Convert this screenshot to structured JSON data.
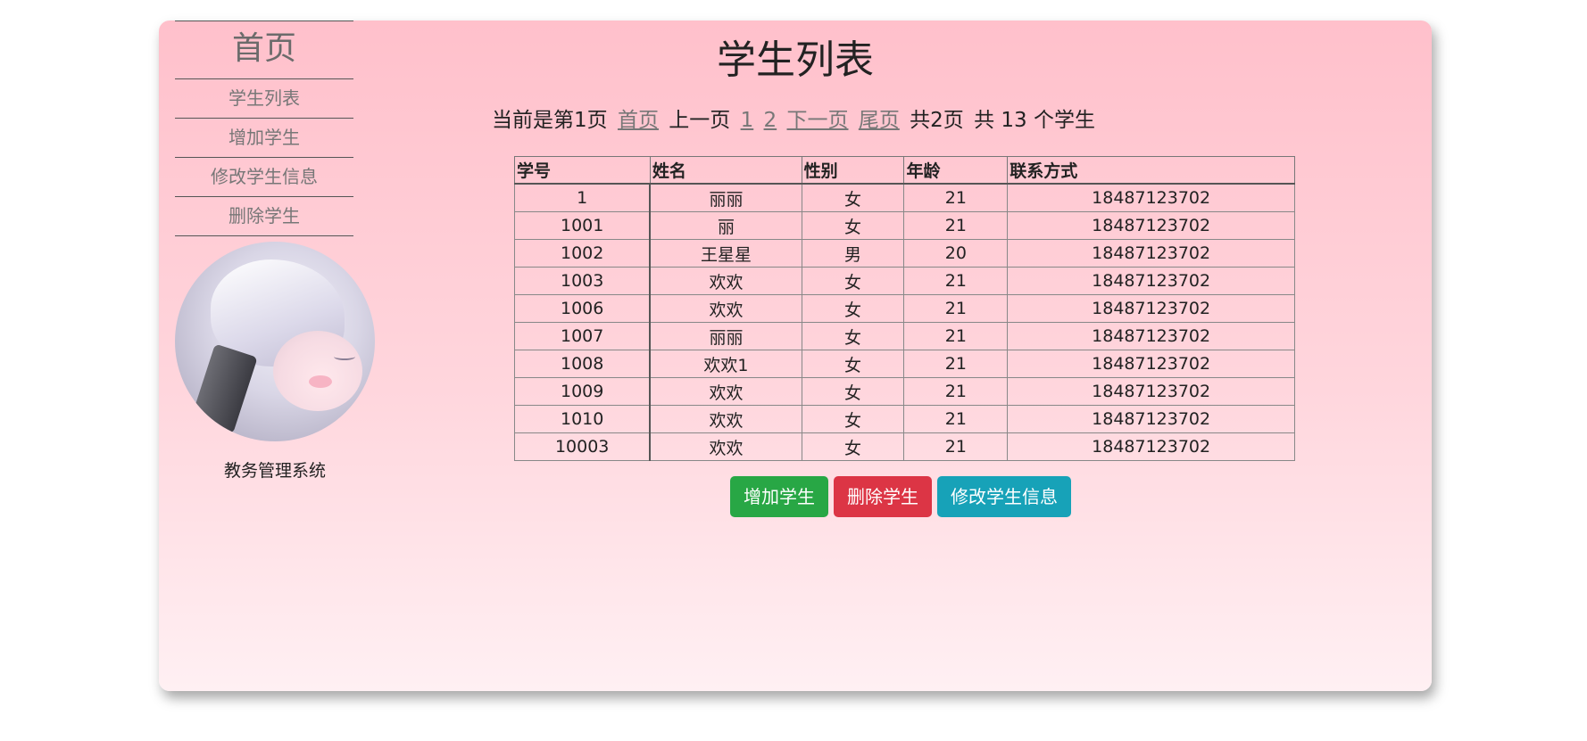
{
  "sidebar": {
    "home": "首页",
    "items": [
      {
        "label": "学生列表"
      },
      {
        "label": "增加学生"
      },
      {
        "label": "修改学生信息"
      },
      {
        "label": "删除学生"
      }
    ],
    "system_name": "教务管理系统"
  },
  "main": {
    "title": "学生列表",
    "pager": {
      "current": "当前是第1页",
      "first": "首页",
      "prev": "上一页",
      "page1": "1",
      "page2": "2",
      "next": "下一页",
      "last": "尾页",
      "total_pages": "共2页",
      "total_students": "共 13 个学生"
    },
    "table": {
      "headers": [
        "学号",
        "姓名",
        "性别",
        "年龄",
        "联系方式"
      ],
      "rows": [
        [
          "1",
          "丽丽",
          "女",
          "21",
          "18487123702"
        ],
        [
          "1001",
          "丽",
          "女",
          "21",
          "18487123702"
        ],
        [
          "1002",
          "王星星",
          "男",
          "20",
          "18487123702"
        ],
        [
          "1003",
          "欢欢",
          "女",
          "21",
          "18487123702"
        ],
        [
          "1006",
          "欢欢",
          "女",
          "21",
          "18487123702"
        ],
        [
          "1007",
          "丽丽",
          "女",
          "21",
          "18487123702"
        ],
        [
          "1008",
          "欢欢1",
          "女",
          "21",
          "18487123702"
        ],
        [
          "1009",
          "欢欢",
          "女",
          "21",
          "18487123702"
        ],
        [
          "1010",
          "欢欢",
          "女",
          "21",
          "18487123702"
        ],
        [
          "10003",
          "欢欢",
          "女",
          "21",
          "18487123702"
        ]
      ]
    },
    "buttons": {
      "add": "增加学生",
      "delete": "删除学生",
      "edit": "修改学生信息"
    }
  },
  "colors": {
    "card_gradient_top": "#ffc0cb",
    "card_gradient_bottom": "#fff0f3",
    "btn_add": "#28a745",
    "btn_delete": "#dc3545",
    "btn_edit": "#17a2b8"
  }
}
